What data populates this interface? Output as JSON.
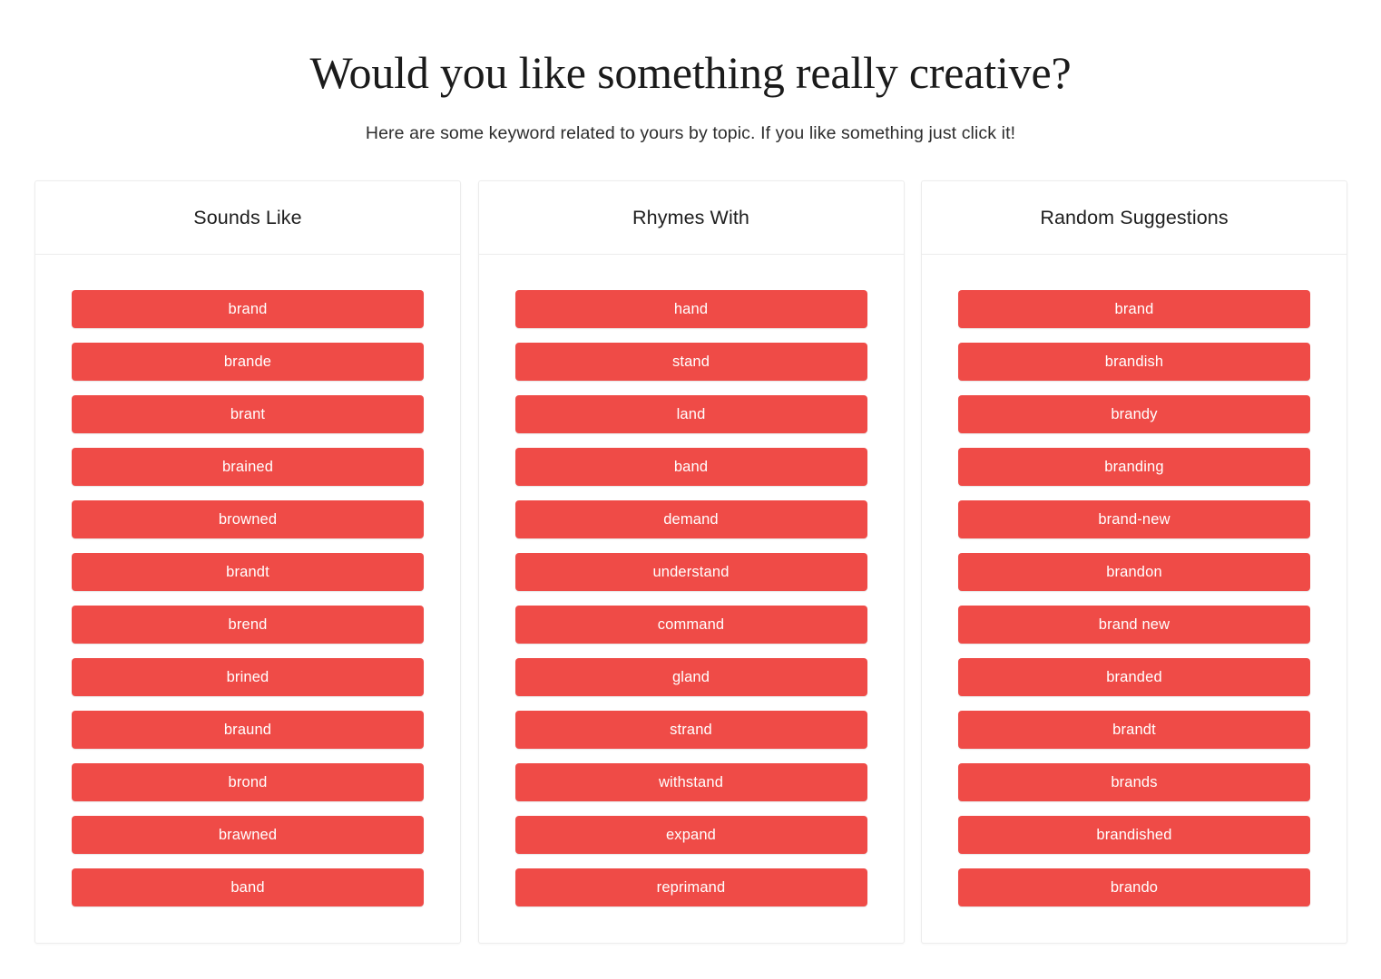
{
  "header": {
    "title": "Would you like something really creative?",
    "subtitle": "Here are some keyword related to yours by topic. If you like something just click it!"
  },
  "theme": {
    "button_color": "#ef4b47",
    "button_text_color": "#ffffff",
    "card_border_color": "#ececec",
    "background": "#ffffff",
    "title_color": "#1b1b1b"
  },
  "columns": [
    {
      "id": "sounds-like",
      "heading": "Sounds Like",
      "items": [
        "brand",
        "brande",
        "brant",
        "brained",
        "browned",
        "brandt",
        "brend",
        "brined",
        "braund",
        "brond",
        "brawned",
        "band"
      ]
    },
    {
      "id": "rhymes-with",
      "heading": "Rhymes With",
      "items": [
        "hand",
        "stand",
        "land",
        "band",
        "demand",
        "understand",
        "command",
        "gland",
        "strand",
        "withstand",
        "expand",
        "reprimand"
      ]
    },
    {
      "id": "random-suggestions",
      "heading": "Random Suggestions",
      "items": [
        "brand",
        "brandish",
        "brandy",
        "branding",
        "brand-new",
        "brandon",
        "brand new",
        "branded",
        "brandt",
        "brands",
        "brandished",
        "brando"
      ]
    }
  ]
}
